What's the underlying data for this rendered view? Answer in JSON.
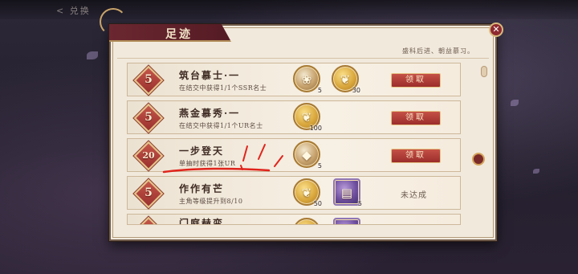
{
  "panel": {
    "title": "足迹",
    "subtitle": "盛科后进、朝益慕习。",
    "close_label": "✕"
  },
  "rows": [
    {
      "badge": "5",
      "title": "筑台慕士·一",
      "desc": "在结交中获得1/1个SSR名士",
      "items": [
        {
          "icon": "fan-icon",
          "count": "5"
        },
        {
          "icon": "feather-icon",
          "count": "30"
        }
      ],
      "action": "领取"
    },
    {
      "badge": "5",
      "title": "燕金慕秀·一",
      "desc": "在结交中获得1/1个UR名士",
      "items": [
        {
          "icon": "feather-icon",
          "count": "100"
        }
      ],
      "action": "领取"
    },
    {
      "badge": "20",
      "title": "一步登天",
      "desc": "单抽时获得1张UR",
      "items": [
        {
          "icon": "crystal-icon",
          "count": "5"
        }
      ],
      "action": "领取"
    },
    {
      "badge": "5",
      "title": "作作有芒",
      "desc": "主角等级提升到8/10",
      "items": [
        {
          "icon": "feather-icon",
          "count": "50"
        },
        {
          "icon": "book-icon",
          "count": "5"
        }
      ],
      "action": "未达成"
    },
    {
      "badge": "5",
      "title": "门庭赫变",
      "desc": "",
      "items": [],
      "action": ""
    }
  ],
  "background": {
    "topbar_text": "< 兑换"
  },
  "colors": {
    "panel_bg": "#f1e9dc",
    "accent_red": "#9b2d2b",
    "gold": "#d9a73c",
    "annotation_red": "#e0241c"
  }
}
